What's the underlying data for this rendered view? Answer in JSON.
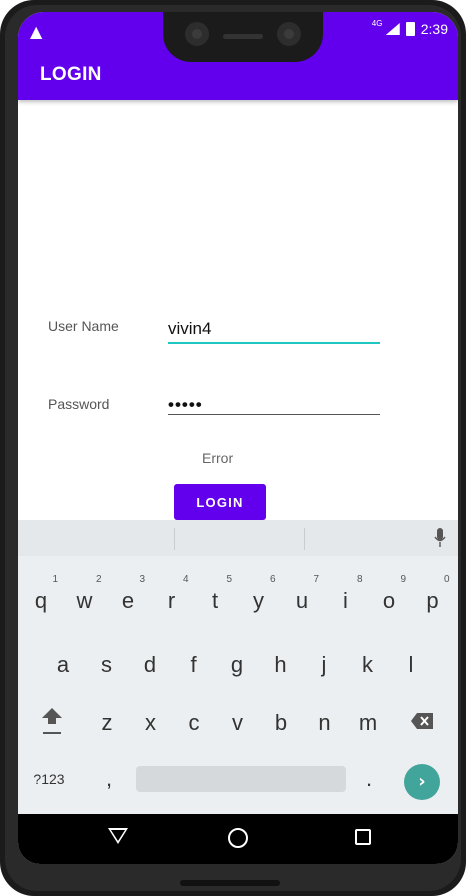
{
  "status": {
    "alert_icon": "warning-icon",
    "network": "4G",
    "time": "2:39"
  },
  "appbar": {
    "title": "LOGIN",
    "color": "#6200ee"
  },
  "form": {
    "username_label": "User Name",
    "username_value": "vivin4",
    "password_label": "Password",
    "password_value": "•••••",
    "error_text": "Error",
    "login_button": "LOGIN"
  },
  "keyboard": {
    "row1": [
      {
        "key": "q",
        "num": "1"
      },
      {
        "key": "w",
        "num": "2"
      },
      {
        "key": "e",
        "num": "3"
      },
      {
        "key": "r",
        "num": "4"
      },
      {
        "key": "t",
        "num": "5"
      },
      {
        "key": "y",
        "num": "6"
      },
      {
        "key": "u",
        "num": "7"
      },
      {
        "key": "i",
        "num": "8"
      },
      {
        "key": "o",
        "num": "9"
      },
      {
        "key": "p",
        "num": "0"
      }
    ],
    "row2": [
      "a",
      "s",
      "d",
      "f",
      "g",
      "h",
      "j",
      "k",
      "l"
    ],
    "row3": [
      "z",
      "x",
      "c",
      "v",
      "b",
      "n",
      "m"
    ],
    "symbols_key": "?123",
    "comma_key": ",",
    "period_key": ".",
    "go_color": "#42a59b"
  },
  "nav": {
    "back_icon": "back-icon",
    "home_icon": "home-icon",
    "recents_icon": "recents-icon"
  }
}
